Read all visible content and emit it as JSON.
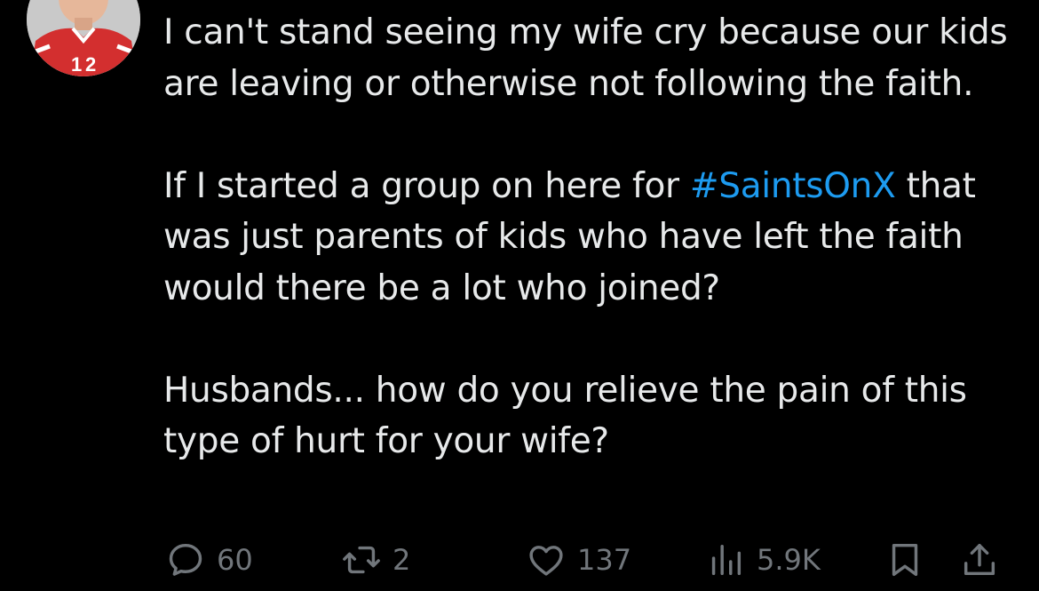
{
  "tweet": {
    "paragraphs": {
      "p1": "I can't stand seeing my wife cry because our kids are leaving or otherwise not following the faith.",
      "p2_before": "If I started a group on here for ",
      "p2_hashtag": "#SaintsOnX",
      "p2_after": " that was just parents of kids who have left the faith would there be a lot who joined?",
      "p3": "Husbands... how do you relieve the pain of this type of hurt for your wife?"
    }
  },
  "actions": {
    "reply_count": "60",
    "retweet_count": "2",
    "like_count": "137",
    "view_count": "5.9K"
  },
  "icons": {
    "reply": "reply-icon",
    "retweet": "retweet-icon",
    "like": "heart-icon",
    "views": "views-chart-icon",
    "bookmark": "bookmark-icon",
    "share": "share-icon"
  },
  "colors": {
    "background": "#000000",
    "text": "#e7e9ea",
    "secondary": "#71767b",
    "hashtag": "#1d9bf0",
    "avatar_jersey": "#d32f2f"
  }
}
